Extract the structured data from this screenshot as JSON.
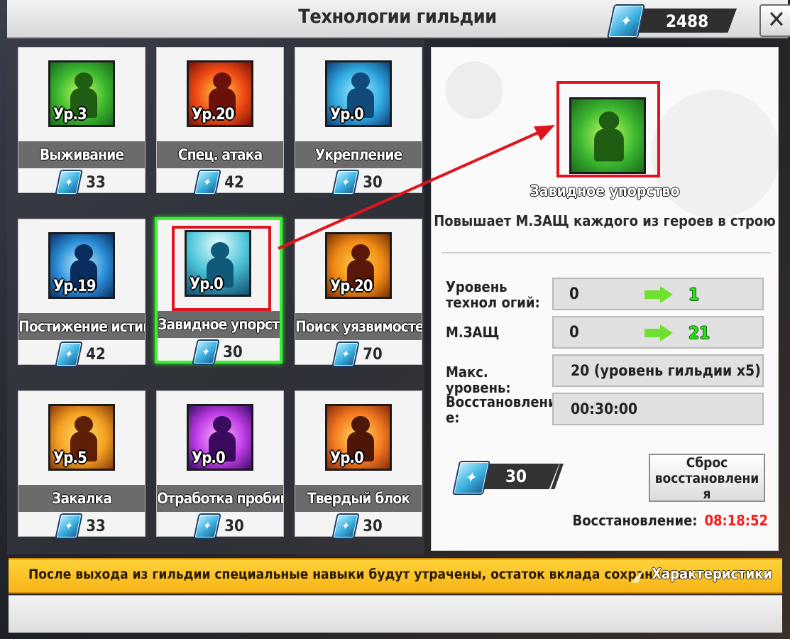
{
  "header": {
    "title": "Технологии гильдии",
    "currency_value": "2488",
    "close_label": "✕"
  },
  "techs": [
    {
      "name": "Выживание",
      "level": "Ур.3",
      "cost": "33",
      "palette": "green"
    },
    {
      "name": "Спец. атака",
      "level": "Ур.20",
      "cost": "42",
      "palette": "red"
    },
    {
      "name": "Укрепление",
      "level": "Ур.0",
      "cost": "30",
      "palette": "blue"
    },
    {
      "name": "Постижение истин",
      "level": "Ур.19",
      "cost": "42",
      "palette": "blue"
    },
    {
      "name": "Завидное упорство",
      "level": "Ур.0",
      "cost": "30",
      "palette": "teal",
      "selected": true
    },
    {
      "name": "Поиск уязвимостей",
      "level": "Ур.20",
      "cost": "70",
      "palette": "orange"
    },
    {
      "name": "Закалка",
      "level": "Ур.5",
      "cost": "33",
      "palette": "orange"
    },
    {
      "name": "Отработка пробивания",
      "level": "Ур.0",
      "cost": "30",
      "palette": "purple"
    },
    {
      "name": "Твердый блок",
      "level": "Ур.0",
      "cost": "30",
      "palette": "orange"
    }
  ],
  "detail": {
    "name": "Завидное упорство",
    "description": "Повышает М.ЗАЩ каждого из героев в строю",
    "stats": {
      "tech_level_label": "Уровень технол огий:",
      "tech_level_current": "0",
      "tech_level_next": "1",
      "mdef_label": "М.ЗАЩ",
      "mdef_current": "0",
      "mdef_next": "21",
      "max_level_label": "Макс. уровень:",
      "max_level_value": "20 (уровень гильдии x5)",
      "cooldown_label": "Восстановлени е:",
      "cooldown_value": "00:30:00"
    },
    "cost": "30",
    "reset_button_label": "Сброс восстановлени я",
    "restore_label": "Восстановление:",
    "restore_timer": "08:18:52"
  },
  "footer": {
    "notice": "После выхода из гильдии специальные навыки будут утрачены, остаток вклада сохраняется.",
    "characteristics_label": "Характеристики"
  },
  "colors": {
    "selected_border": "#3af12f",
    "highlight_red": "#e0141e",
    "timer_red": "#ff1a1a",
    "next_value_green": "#2fdd1e",
    "notice_bar": "#f6b417"
  },
  "icons": {
    "currency": "crystal-icon",
    "close": "close-icon",
    "characteristics": "feather-icon"
  }
}
